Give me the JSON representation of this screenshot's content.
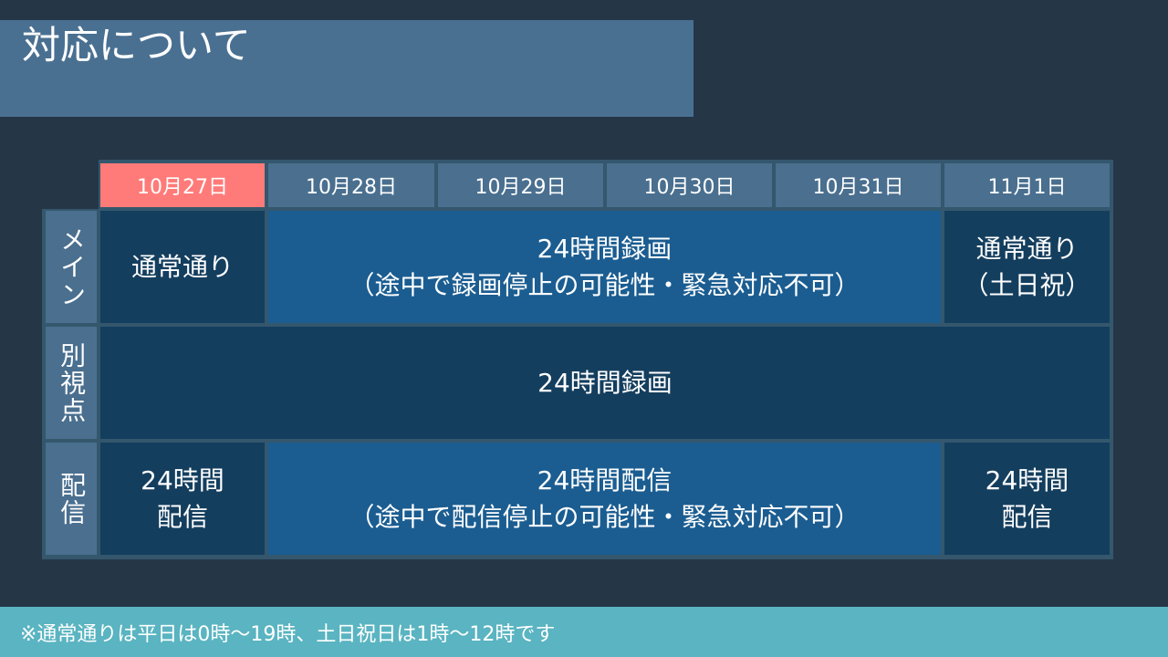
{
  "title": "対応について",
  "dates": [
    "10月27日",
    "10月28日",
    "10月29日",
    "10月30日",
    "10月31日",
    "11月1日"
  ],
  "rows": {
    "main": {
      "label": "メイン",
      "first": "通常通り",
      "middle_line1": "24時間録画",
      "middle_line2": "（途中で録画停止の可能性・緊急対応不可）",
      "last_line1": "通常通り",
      "last_line2": "（土日祝）"
    },
    "alt": {
      "label": "別視点",
      "all": "24時間録画"
    },
    "stream": {
      "label": "配信",
      "first_line1": "24時間",
      "first_line2": "配信",
      "middle_line1": "24時間配信",
      "middle_line2": "（途中で配信停止の可能性・緊急対応不可）",
      "last_line1": "24時間",
      "last_line2": "配信"
    }
  },
  "footer": "※通常通りは平日は0時〜19時、土日祝日は1時〜12時です",
  "colors": {
    "background": "#253646",
    "title_bar": "#4a7091",
    "today_highlight": "#ff7b79",
    "cell_dark": "#143e5e",
    "cell_mid": "#1b5d91",
    "footer_bar": "#5ab4c1"
  }
}
